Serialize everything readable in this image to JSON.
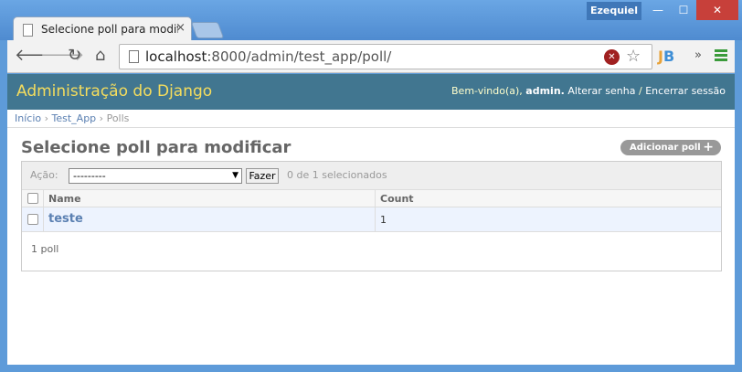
{
  "browser": {
    "tab_title": "Selecione poll para modificar",
    "tab_close": "×",
    "user_badge": "Ezequiel",
    "window_controls": {
      "minimize": "—",
      "maximize": "☐",
      "close": "✕"
    },
    "url_host": "localhost",
    "url_path": ":8000/admin/test_app/poll/",
    "extension_label_j": "J",
    "extension_label_b": "B",
    "overflow": "»",
    "icons": [
      "back-icon",
      "forward-icon",
      "reload-icon",
      "home-icon",
      "page-icon",
      "blocked-icon",
      "star-icon",
      "jb-extension-icon",
      "menu-icon"
    ]
  },
  "admin": {
    "branding": "Administração do Django",
    "welcome": "Bem-vindo(a),",
    "username": "admin",
    "change_password": "Alterar senha",
    "separator": "/",
    "logout": "Encerrar sessão"
  },
  "breadcrumbs": [
    "Início",
    "Test_App",
    "Polls"
  ],
  "breadcrumb_sep": "›",
  "content": {
    "title": "Selecione poll para modificar",
    "add_button": "Adicionar poll",
    "add_plus": "+"
  },
  "actions": {
    "label": "Ação:",
    "selected_option": "---------",
    "go_button": "Fazer",
    "counter": "0 de 1 selecionados"
  },
  "table": {
    "headers": [
      "Name",
      "Count"
    ],
    "rows": [
      {
        "name": "teste",
        "count": "1"
      }
    ]
  },
  "paginator": "1 poll",
  "colors": {
    "header_bg": "#417690",
    "branding": "#f5dd5d",
    "link": "#5b80b2",
    "row_bg": "#edf3fe",
    "close_button": "#c7403a"
  }
}
